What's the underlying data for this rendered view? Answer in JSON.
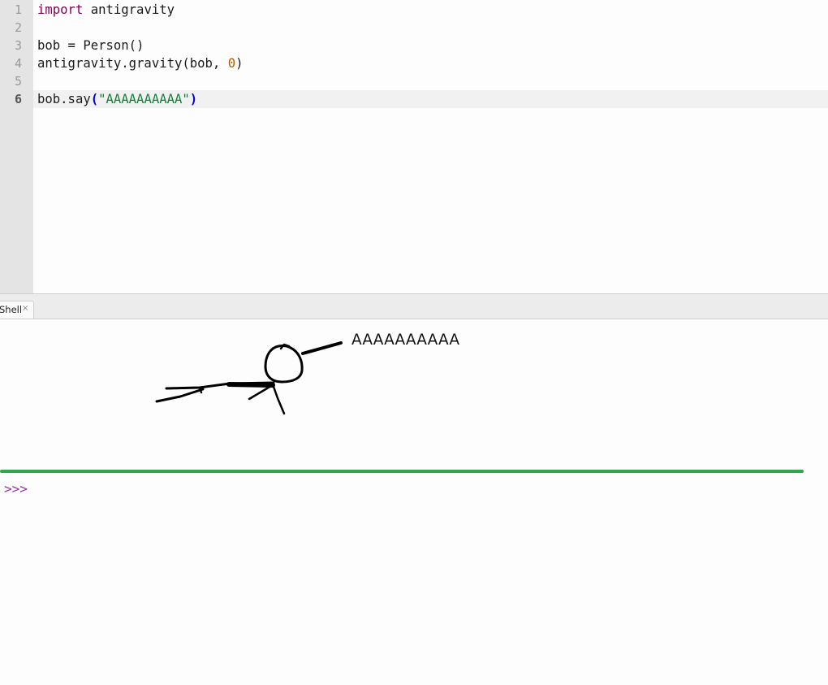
{
  "editor": {
    "line_numbers": [
      "1",
      "2",
      "3",
      "4",
      "5",
      "6"
    ],
    "current_line": 6,
    "lines": {
      "l1_kw": "import",
      "l1_rest": " antigravity",
      "l3": "bob = Person()",
      "l4_pre": "antigravity.gravity(bob, ",
      "l4_num": "0",
      "l4_post": ")",
      "l6_pre": "bob.say",
      "l6_open": "(",
      "l6_str": "\"AAAAAAAAAA\"",
      "l6_close": ")"
    }
  },
  "tabs": {
    "shell_label": "Shell",
    "shell_close": "×"
  },
  "shell": {
    "output_text": "AAAAAAAAAA",
    "prompt": ">>>"
  },
  "colors": {
    "keyword": "#7f0055",
    "number": "#b25a00",
    "string": "#15803d",
    "paren_highlight": "#0000e0",
    "prompt": "#9b2fa0",
    "divider_line": "#2ea84a"
  },
  "icons": {
    "drawing": "stick-figure-flying-drawing",
    "tab_close": "close-icon"
  }
}
